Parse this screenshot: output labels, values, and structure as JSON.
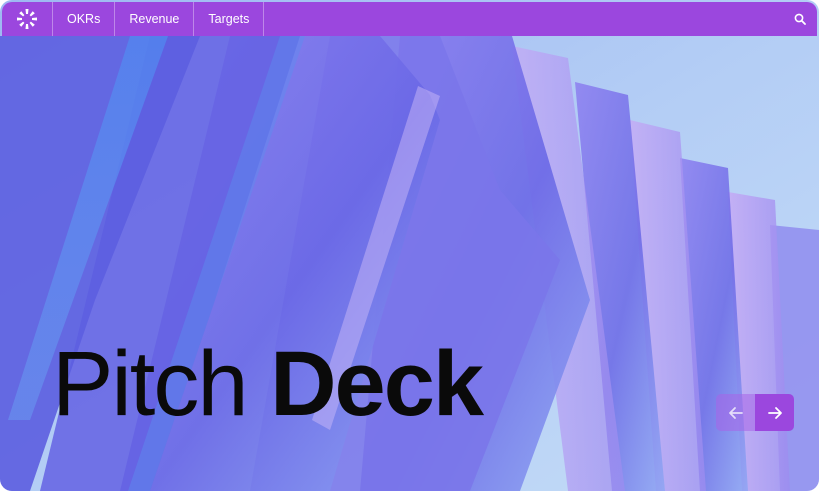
{
  "nav": {
    "items": [
      {
        "label": "OKRs"
      },
      {
        "label": "Revenue"
      },
      {
        "label": "Targets"
      }
    ],
    "logo_icon": "sunburst-logo-icon",
    "search_icon": "search-icon"
  },
  "hero": {
    "title_light": "Pitch",
    "title_bold": "Deck",
    "prev_icon": "arrow-left-icon",
    "next_icon": "arrow-right-icon"
  },
  "colors": {
    "accent": "#9b47de",
    "background_top": "#a9c9f2",
    "panel_main": "#6f6ae8",
    "title_text": "#0a0a0a"
  }
}
